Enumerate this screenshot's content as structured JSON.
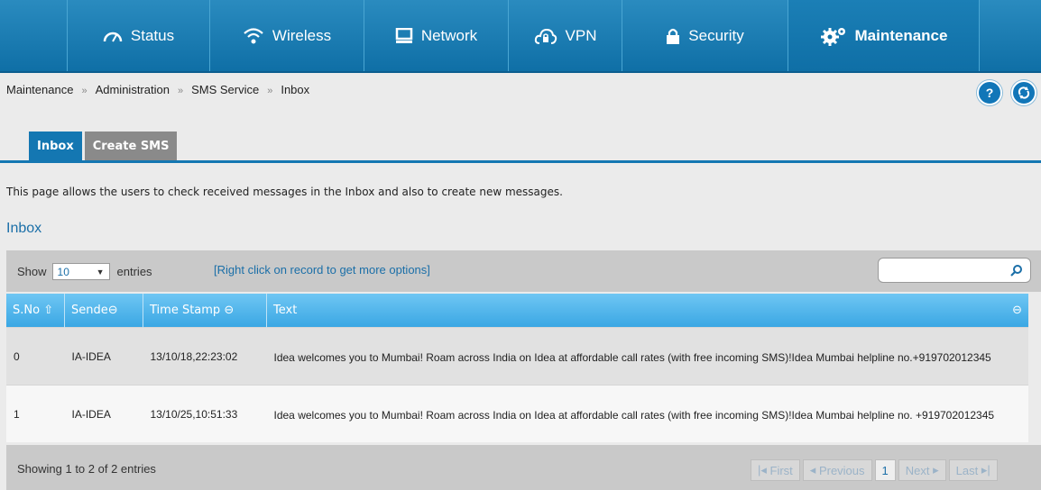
{
  "nav": {
    "items": [
      {
        "label": "Status",
        "icon": "gauge-icon"
      },
      {
        "label": "Wireless",
        "icon": "wifi-icon"
      },
      {
        "label": "Network",
        "icon": "monitor-icon"
      },
      {
        "label": "VPN",
        "icon": "cloud-lock-icon"
      },
      {
        "label": "Security",
        "icon": "lock-icon"
      },
      {
        "label": "Maintenance",
        "icon": "gears-icon"
      }
    ]
  },
  "breadcrumb": {
    "items": [
      "Maintenance",
      "Administration",
      "SMS Service",
      "Inbox"
    ],
    "sep": "»"
  },
  "help": {
    "label": "?"
  },
  "tabs": [
    {
      "label": "Inbox",
      "active": true
    },
    {
      "label": "Create SMS",
      "active": false
    }
  ],
  "description": "This page allows the users to check received messages in the Inbox and also to create new messages.",
  "section_title": "Inbox",
  "toolbar": {
    "show_label": "Show",
    "entries_value": "10",
    "entries_label": "entries",
    "hint": "[Right click on record to get more options]"
  },
  "table": {
    "columns": [
      "S.No",
      "Sende",
      "Time Stamp",
      "Text"
    ],
    "rows": [
      {
        "sno": "0",
        "sender": "IA-IDEA",
        "timestamp": "13/10/18,22:23:02",
        "text": "Idea welcomes you to Mumbai! Roam across India on Idea at affordable call rates (with free incoming SMS)!Idea Mumbai helpline no.+919702012345"
      },
      {
        "sno": "1",
        "sender": "IA-IDEA",
        "timestamp": "13/10/25,10:51:33",
        "text": "Idea welcomes you to Mumbai! Roam across India on Idea at affordable call rates (with free incoming SMS)!Idea Mumbai helpline no. +919702012345"
      }
    ]
  },
  "footer": {
    "info": "Showing 1 to 2 of 2 entries",
    "pager": {
      "first": "First",
      "previous": "Previous",
      "current": "1",
      "next": "Next",
      "last": "Last"
    }
  }
}
